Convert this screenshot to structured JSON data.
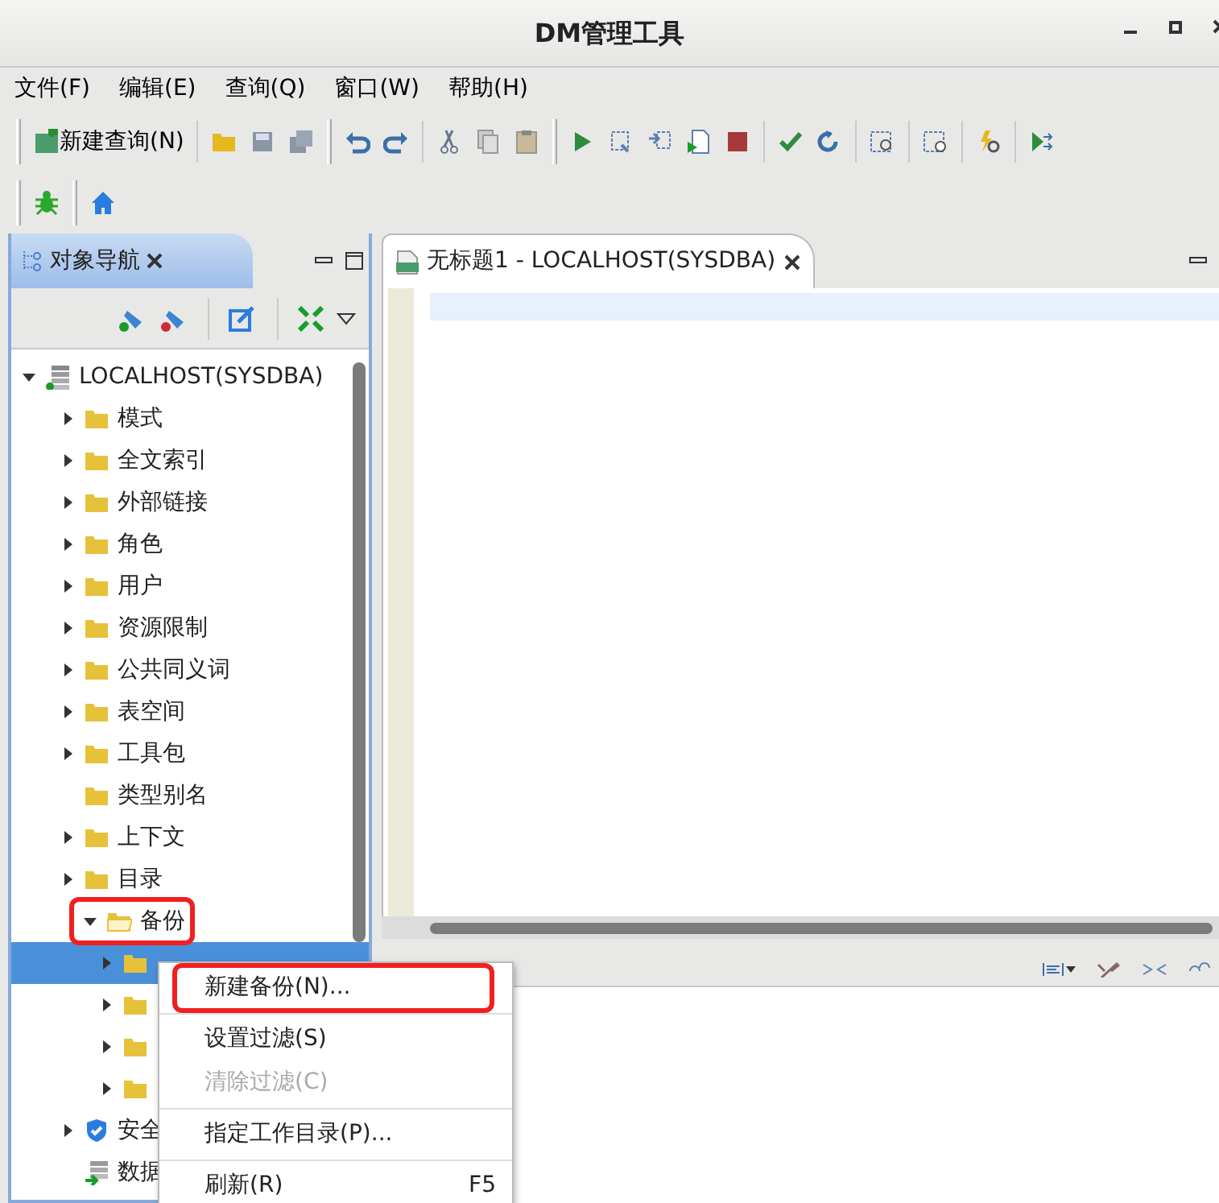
{
  "window": {
    "title": "DM管理工具"
  },
  "menu_bar": [
    "文件(F)",
    "编辑(E)",
    "查询(Q)",
    "窗口(W)",
    "帮助(H)"
  ],
  "toolbar": {
    "new_query_button": "新建查询(N)"
  },
  "object_navigator": {
    "tab": {
      "label": "对象导航",
      "selected": true
    },
    "tree": {
      "label": "LOCALHOST(SYSDBA)",
      "kind": "server",
      "expanded": true,
      "children": [
        {
          "label": "模式",
          "kind": "folder",
          "expandable": true,
          "expanded": false,
          "selected": false,
          "highlighted": false
        },
        {
          "label": "全文索引",
          "kind": "folder",
          "expandable": true,
          "expanded": false,
          "selected": false,
          "highlighted": false
        },
        {
          "label": "外部链接",
          "kind": "folder",
          "expandable": true,
          "expanded": false,
          "selected": false,
          "highlighted": false
        },
        {
          "label": "角色",
          "kind": "folder",
          "expandable": true,
          "expanded": false,
          "selected": false,
          "highlighted": false
        },
        {
          "label": "用户",
          "kind": "folder",
          "expandable": true,
          "expanded": false,
          "selected": false,
          "highlighted": false
        },
        {
          "label": "资源限制",
          "kind": "folder",
          "expandable": true,
          "expanded": false,
          "selected": false,
          "highlighted": false
        },
        {
          "label": "公共同义词",
          "kind": "folder",
          "expandable": true,
          "expanded": false,
          "selected": false,
          "highlighted": false
        },
        {
          "label": "表空间",
          "kind": "folder",
          "expandable": true,
          "expanded": false,
          "selected": false,
          "highlighted": false
        },
        {
          "label": "工具包",
          "kind": "folder",
          "expandable": true,
          "expanded": false,
          "selected": false,
          "highlighted": false
        },
        {
          "label": "类型别名",
          "kind": "folder",
          "expandable": false,
          "selected": false,
          "highlighted": false
        },
        {
          "label": "上下文",
          "kind": "folder",
          "expandable": true,
          "expanded": false,
          "selected": false,
          "highlighted": false
        },
        {
          "label": "目录",
          "kind": "folder",
          "expandable": true,
          "expanded": false,
          "selected": false,
          "highlighted": false
        },
        {
          "label": "备份",
          "kind": "folder",
          "expandable": true,
          "expanded": true,
          "selected": false,
          "highlighted": true,
          "children": [
            {
              "kind": "folder",
              "expandable": true,
              "expanded": false,
              "selected": true,
              "highlighted": false
            },
            {
              "kind": "folder",
              "expandable": true,
              "expanded": false,
              "selected": false,
              "highlighted": false
            },
            {
              "kind": "folder",
              "expandable": true,
              "expanded": false,
              "selected": false,
              "highlighted": false
            },
            {
              "kind": "folder",
              "expandable": true,
              "expanded": false,
              "selected": false,
              "highlighted": false
            }
          ]
        },
        {
          "label": "安全",
          "kind": "security",
          "expandable": true,
          "expanded": false,
          "selected": false,
          "highlighted": false
        },
        {
          "label": "数据",
          "kind": "database",
          "expandable": false,
          "selected": false,
          "highlighted": false
        }
      ]
    }
  },
  "editor": {
    "tab": {
      "label": "无标题1 - LOCALHOST(SYSDBA)",
      "selected": true
    }
  },
  "context_menu": [
    {
      "kind": "item",
      "label": "新建备份(N)...",
      "disabled": false,
      "highlighted": true
    },
    {
      "kind": "separator"
    },
    {
      "kind": "item",
      "label": "设置过滤(S)",
      "disabled": false,
      "highlighted": false
    },
    {
      "kind": "item",
      "label": "清除过滤(C)",
      "disabled": true,
      "highlighted": false
    },
    {
      "kind": "separator"
    },
    {
      "kind": "item",
      "label": "指定工作目录(P)...",
      "disabled": false,
      "highlighted": false
    },
    {
      "kind": "separator"
    },
    {
      "kind": "item",
      "label": "刷新(R)",
      "shortcut": "F5",
      "disabled": false,
      "highlighted": false
    }
  ]
}
